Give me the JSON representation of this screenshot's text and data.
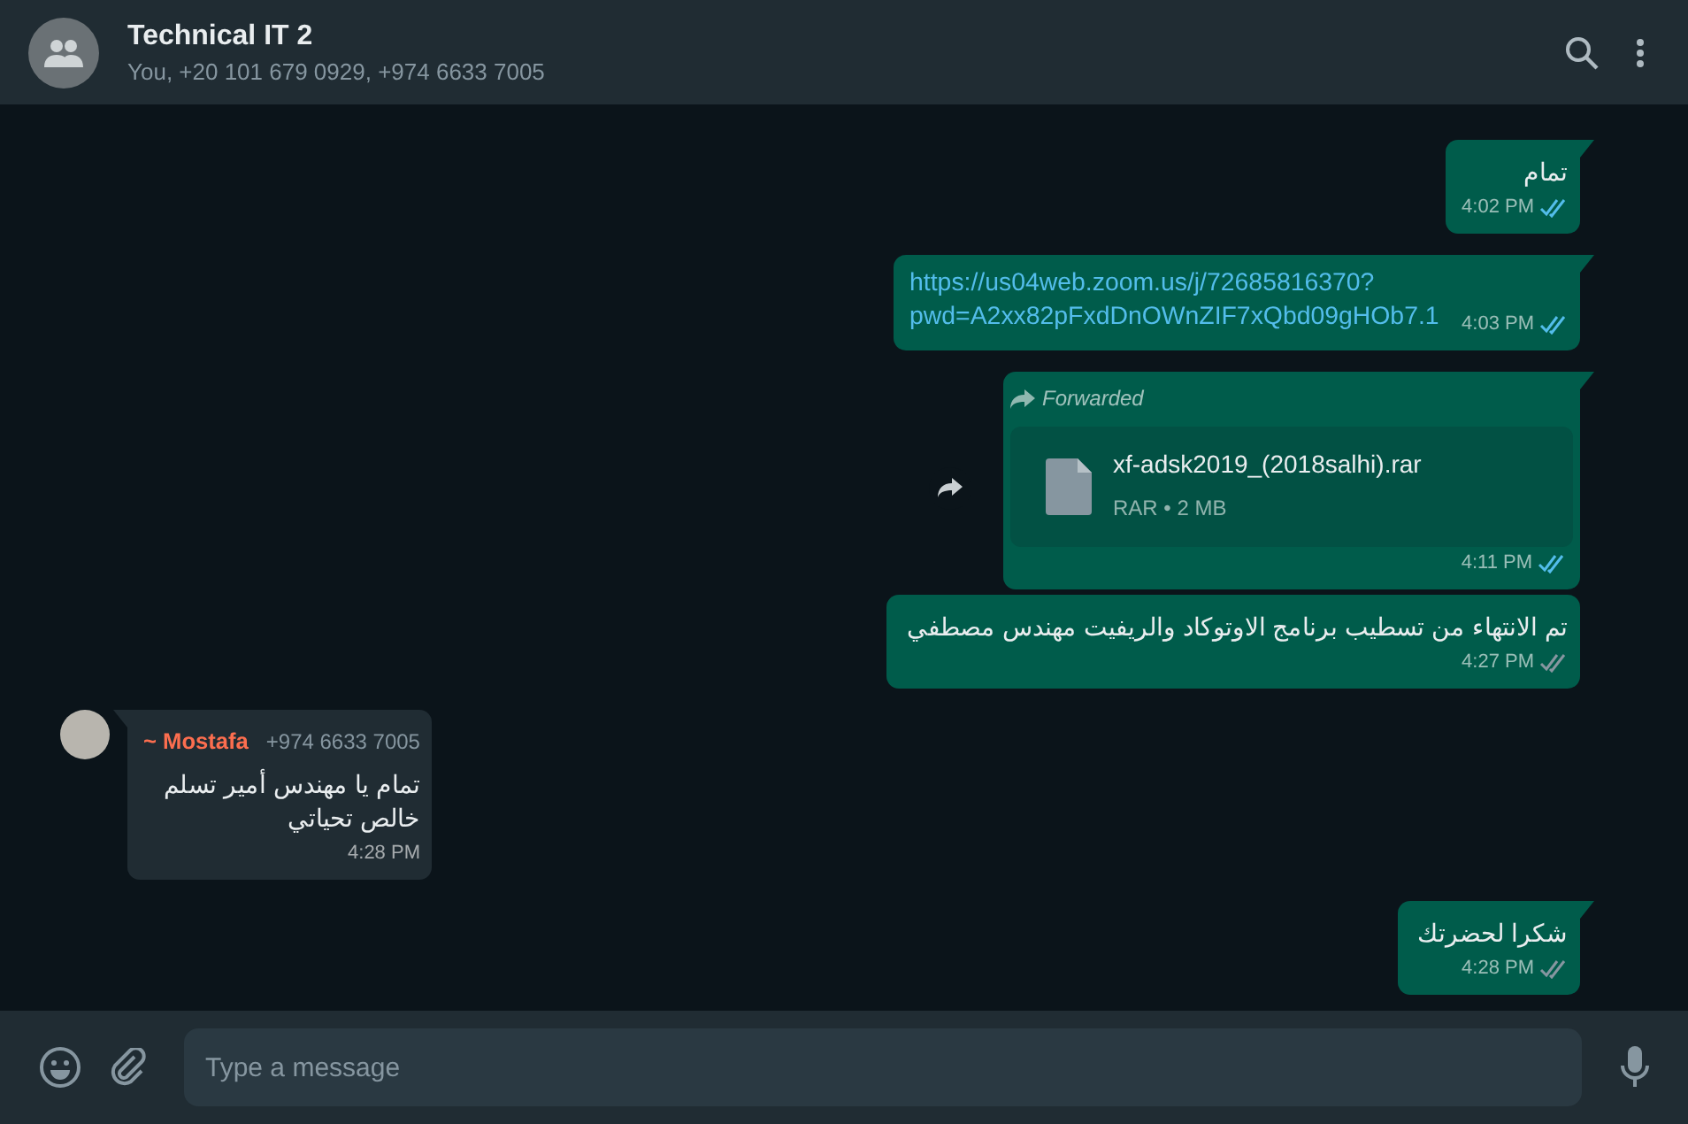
{
  "header": {
    "title": "Technical IT 2",
    "subtitle": "You, +20 101 679 0929, +974 6633 7005"
  },
  "messages": [
    {
      "kind": "text",
      "outgoing": true,
      "tail": true,
      "text": "تمام",
      "time": "4:02 PM",
      "read": true
    },
    {
      "kind": "link",
      "outgoing": true,
      "tail": true,
      "text": "https://us04web.zoom.us/j/72685816370?pwd=A2xx82pFxdDnOWnZIF7xQbd09gHOb7.1",
      "time": "4:03 PM",
      "read": true
    },
    {
      "kind": "file",
      "outgoing": true,
      "tail": true,
      "forwarded_label": "Forwarded",
      "file_name": "xf-adsk2019_(2018salhi).rar",
      "file_meta": "RAR • 2 MB",
      "time": "4:11 PM",
      "read": true
    },
    {
      "kind": "text",
      "outgoing": true,
      "tail": false,
      "text": "تم الانتهاء من تسطيب برنامج الاوتوكاد والريفيت مهندس مصطفي",
      "time": "4:27 PM",
      "read": false
    },
    {
      "kind": "text",
      "outgoing": false,
      "tail": true,
      "sender": "~ Mostafa",
      "phone": "+974 6633 7005",
      "text": "تمام يا مهندس أمير تسلم خالص تحياتي",
      "time": "4:28 PM"
    },
    {
      "kind": "text",
      "outgoing": true,
      "tail": true,
      "text": "شكرا لحضرتك",
      "time": "4:28 PM",
      "read": false
    }
  ],
  "composer": {
    "placeholder": "Type a message"
  }
}
